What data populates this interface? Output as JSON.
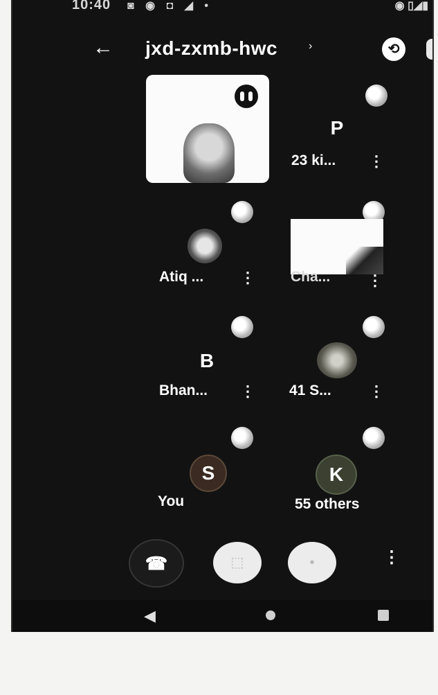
{
  "status_bar": {
    "time": "10:40",
    "left_icons": "◙ ◉ ◘ ◢ •",
    "right_icons": "◉ ▯◢▮"
  },
  "header": {
    "back_glyph": "←",
    "meeting_code": "jxd-zxmb-hwc",
    "caret_glyph": "›",
    "switch_camera_icon": "switch-camera-icon"
  },
  "participants": [
    {
      "id": "self-video",
      "label": "",
      "initial": "",
      "has_video": true
    },
    {
      "id": "p",
      "label": "23 ki...",
      "initial": "P"
    },
    {
      "id": "atiq",
      "label": "Atiq ...",
      "initial": ""
    },
    {
      "id": "cha",
      "label": "Cha...",
      "initial": "",
      "has_video": true
    },
    {
      "id": "b",
      "label": "Bhan...",
      "initial": "B"
    },
    {
      "id": "41s",
      "label": "41 S...",
      "initial": ""
    },
    {
      "id": "you",
      "label": "You",
      "initial": "S"
    },
    {
      "id": "others",
      "label": "55 others",
      "initial": "K"
    }
  ],
  "controls": {
    "hangup_icon": "hangup-icon",
    "hangup_glyph": "☎",
    "camera_glyph": "⬚",
    "mic_glyph": "•",
    "more_glyph": "⋮"
  },
  "nav": {
    "back_glyph": "◀"
  },
  "colors": {
    "background": "#121212",
    "text": "#ffffff",
    "avatar_p": "#121212",
    "avatar_s": "#3a2a22",
    "avatar_k": "#3b4030"
  }
}
